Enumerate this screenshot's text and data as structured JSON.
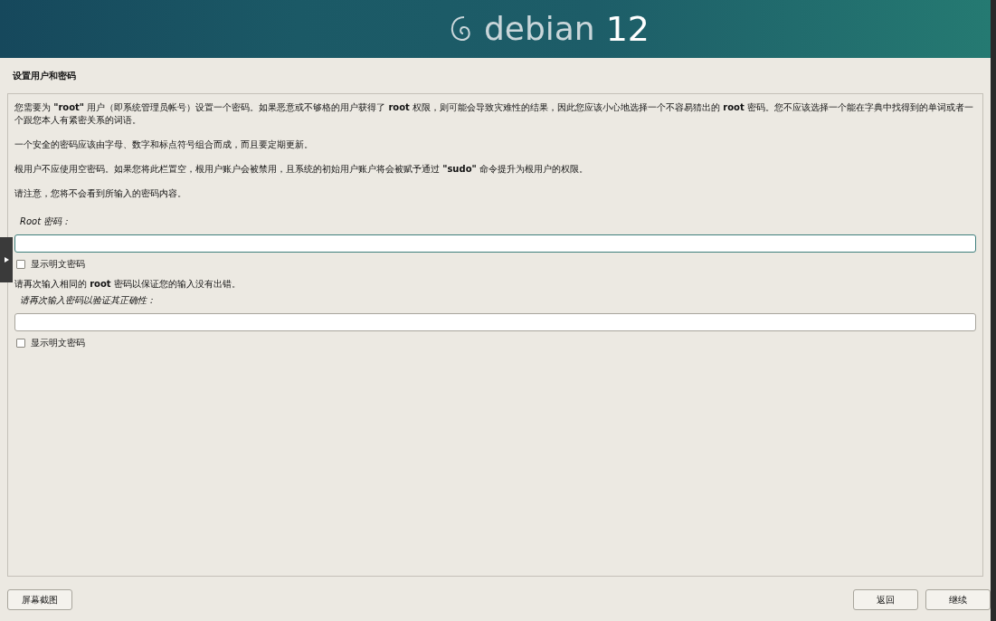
{
  "banner": {
    "logo_text": "debian",
    "version": "12"
  },
  "title": "设置用户和密码",
  "paragraphs": [
    "您需要为 **\"root\"** 用户（即系统管理员帐号）设置一个密码。如果恶意或不够格的用户获得了 **root** 权限，则可能会导致灾难性的结果，因此您应该小心地选择一个不容易猜出的 **root** 密码。您不应该选择一个能在字典中找得到的单词或者一个跟您本人有紧密关系的词语。",
    "一个安全的密码应该由字母、数字和标点符号组合而成，而且要定期更新。",
    "根用户不应使用空密码。如果您将此栏置空，根用户账户会被禁用，且系统的初始用户账户将会被赋予通过 **\"sudo\"** 命令提升为根用户的权限。",
    "请注意，您将不会看到所输入的密码内容。"
  ],
  "fields": [
    {
      "label": "Root 密码：",
      "focused": true,
      "checkbox": {
        "label": "显示明文密码",
        "checked": false
      }
    },
    {
      "intro": "请再次输入相同的 **root** 密码以保证您的输入没有出错。",
      "label": "请再次输入密码以验证其正确性：",
      "focused": false,
      "checkbox": {
        "label": "显示明文密码",
        "checked": false
      }
    }
  ],
  "buttons": {
    "left": [
      "屏幕截图"
    ],
    "right": [
      "返回",
      "继续"
    ]
  }
}
